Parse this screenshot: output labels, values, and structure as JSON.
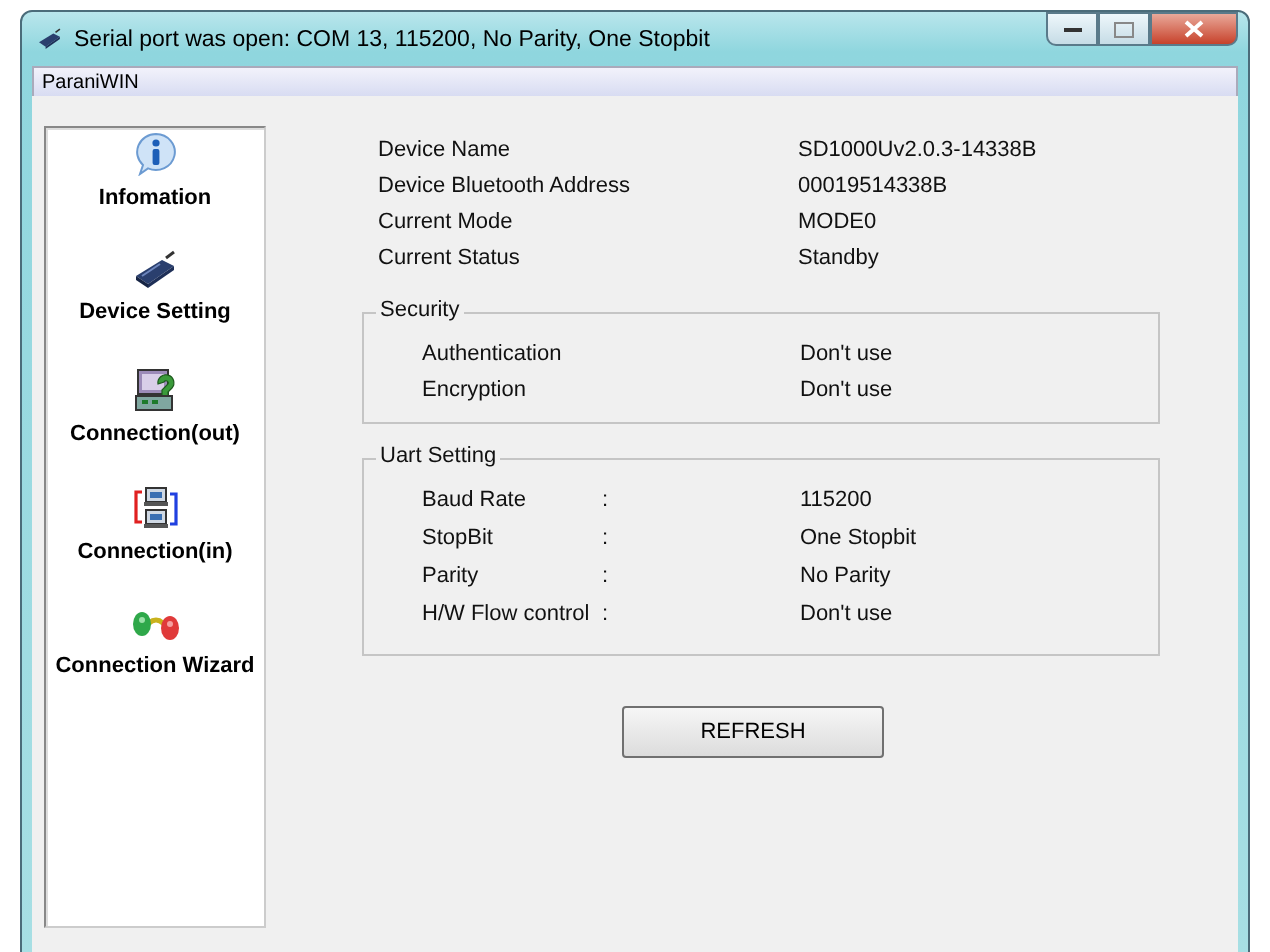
{
  "window": {
    "title": "Serial port was open: COM 13, 115200, No Parity, One Stopbit"
  },
  "menu_bar": {
    "title": "ParaniWIN"
  },
  "sidebar": {
    "items": [
      {
        "label": "Infomation"
      },
      {
        "label": "Device Setting"
      },
      {
        "label": "Connection(out)"
      },
      {
        "label": "Connection(in)"
      },
      {
        "label": "Connection Wizard"
      }
    ]
  },
  "device_info": [
    {
      "label": "Device Name",
      "value": "SD1000Uv2.0.3-14338B"
    },
    {
      "label": "Device Bluetooth Address",
      "value": "00019514338B"
    },
    {
      "label": "Current Mode",
      "value": "MODE0"
    },
    {
      "label": "Current Status",
      "value": "Standby"
    }
  ],
  "security": {
    "title": "Security",
    "rows": [
      {
        "label": "Authentication",
        "value": "Don't use"
      },
      {
        "label": "Encryption",
        "value": "Don't use"
      }
    ]
  },
  "uart_setting": {
    "title": "Uart Setting",
    "rows": [
      {
        "label": "Baud Rate",
        "separator": ":",
        "value": "115200"
      },
      {
        "label": "StopBit",
        "separator": ":",
        "value": "One Stopbit"
      },
      {
        "label": "Parity",
        "separator": ":",
        "value": "No Parity"
      },
      {
        "label": "H/W Flow control",
        "separator": ":",
        "value": "Don't use"
      }
    ]
  },
  "refresh_button": {
    "label": "REFRESH"
  }
}
